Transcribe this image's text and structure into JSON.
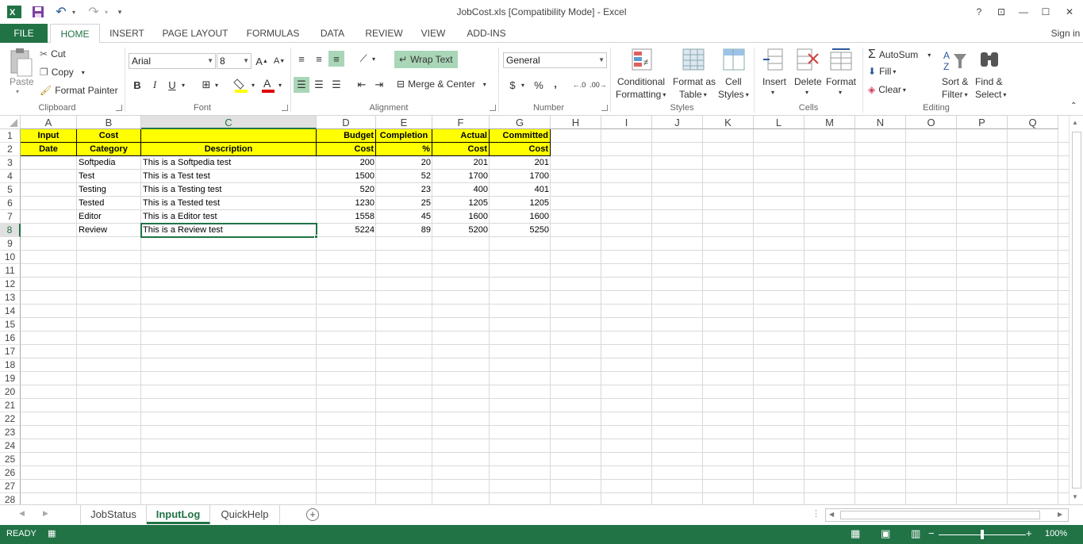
{
  "window": {
    "title": "JobCost.xls  [Compatibility Mode] - Excel",
    "help": "?",
    "restore_ribbon": "⊡",
    "minimize": "—",
    "maximize": "☐",
    "close": "✕",
    "sign_in": "Sign in"
  },
  "tabs": [
    "FILE",
    "HOME",
    "INSERT",
    "PAGE LAYOUT",
    "FORMULAS",
    "DATA",
    "REVIEW",
    "VIEW",
    "ADD-INS"
  ],
  "ribbon": {
    "clipboard": {
      "label": "Clipboard",
      "paste": "Paste",
      "cut": "Cut",
      "copy": "Copy",
      "format_painter": "Format Painter"
    },
    "font": {
      "label": "Font",
      "name": "Arial",
      "size": "8",
      "bold": "B",
      "italic": "I",
      "underline": "U",
      "grow": "A",
      "shrink": "A"
    },
    "alignment": {
      "label": "Alignment",
      "wrap_text": "Wrap Text",
      "merge_center": "Merge & Center"
    },
    "number": {
      "label": "Number",
      "format": "General",
      "currency": "$",
      "percent": "%",
      "comma": ","
    },
    "styles": {
      "label": "Styles",
      "conditional": "Conditional",
      "conditional2": "Formatting",
      "format_as": "Format as",
      "format_as2": "Table",
      "cell": "Cell",
      "cell2": "Styles"
    },
    "cells": {
      "label": "Cells",
      "insert": "Insert",
      "delete": "Delete",
      "format": "Format"
    },
    "editing": {
      "label": "Editing",
      "autosum": "AutoSum",
      "fill": "Fill",
      "clear": "Clear",
      "sort": "Sort &",
      "sort2": "Filter",
      "find": "Find &",
      "find2": "Select"
    }
  },
  "columns": [
    "A",
    "B",
    "C",
    "D",
    "E",
    "F",
    "G",
    "H",
    "I",
    "J",
    "K",
    "L",
    "M",
    "N",
    "O",
    "P",
    "Q"
  ],
  "rows": [
    "1",
    "2",
    "3",
    "4",
    "5",
    "6",
    "7",
    "8",
    "9",
    "10",
    "11",
    "12",
    "13",
    "14",
    "15",
    "16",
    "17",
    "18",
    "19",
    "20",
    "21",
    "22",
    "23",
    "24",
    "25",
    "26",
    "27",
    "28"
  ],
  "header_row1": [
    "Input",
    "Cost",
    "",
    "Budget",
    "Completion",
    "Actual",
    "Committed"
  ],
  "header_row2": [
    "Date",
    "Category",
    "Description",
    "Cost",
    "%",
    "Cost",
    "Cost"
  ],
  "data_rows": [
    [
      "",
      "Softpedia",
      "This is a Softpedia test",
      "200",
      "20",
      "201",
      "201"
    ],
    [
      "",
      "Test",
      "This is a Test test",
      "1500",
      "52",
      "1700",
      "1700"
    ],
    [
      "",
      "Testing",
      "This is a Testing test",
      "520",
      "23",
      "400",
      "401"
    ],
    [
      "",
      "Tested",
      "This is a Tested test",
      "1230",
      "25",
      "1205",
      "1205"
    ],
    [
      "",
      "Editor",
      "This is a Editor test",
      "1558",
      "45",
      "1600",
      "1600"
    ],
    [
      "",
      "Review",
      "This is a Review test",
      "5224",
      "89",
      "5200",
      "5250"
    ]
  ],
  "sheets": [
    "JobStatus",
    "InputLog",
    "QuickHelp"
  ],
  "active_sheet": "InputLog",
  "status": {
    "mode": "READY",
    "zoom": "100%"
  }
}
